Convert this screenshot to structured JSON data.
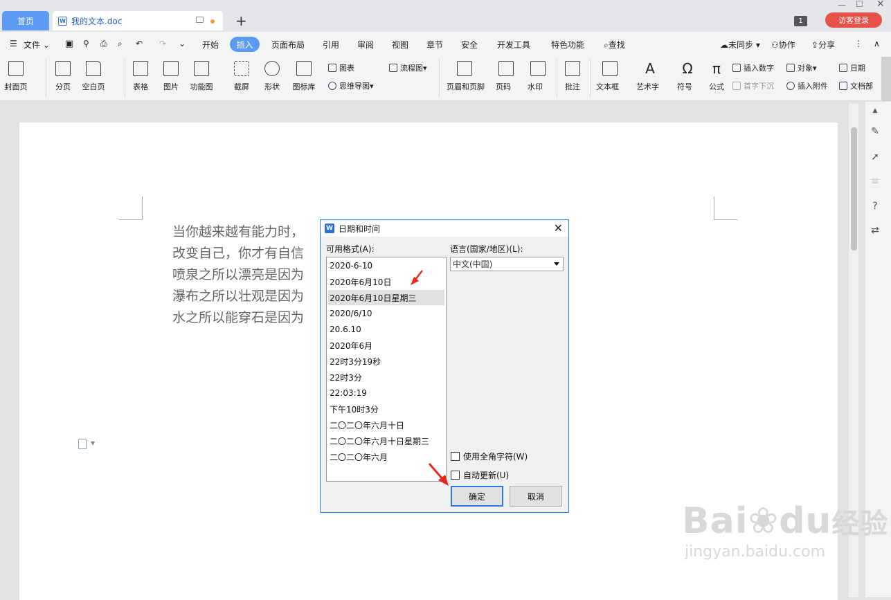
{
  "tabs": {
    "home": "首页",
    "doc": "我的文本.doc"
  },
  "topright": {
    "badge": "1",
    "login": "访客登录"
  },
  "menu": {
    "file": "文件",
    "items": [
      "开始",
      "插入",
      "页面布局",
      "引用",
      "审阅",
      "视图",
      "章节",
      "安全",
      "开发工具",
      "特色功能",
      "查找"
    ],
    "sync": "未同步",
    "collab": "协作",
    "share": "分享"
  },
  "ribbon": {
    "cover": "封面页",
    "pagebreak": "分页",
    "blank": "空白页",
    "table": "表格",
    "picture": "图片",
    "funcchart": "功能图",
    "screenshot": "截屏",
    "shape": "形状",
    "iconlib": "图标库",
    "chart": "图表",
    "mindmap": "思维导图",
    "flowchart": "流程图",
    "headerfooter": "页眉和页脚",
    "pagenum": "页码",
    "watermark": "水印",
    "comment": "批注",
    "textbox": "文本框",
    "wordart": "艺术字",
    "symbol": "符号",
    "formula": "公式",
    "insertnum": "插入数字",
    "object": "对象",
    "date": "日期",
    "dropcap": "首字下沉",
    "attach": "插入附件",
    "docpart": "文档部"
  },
  "document": {
    "lines": [
      "当你越来越有能力时，",
      "改变自己，你才有自信",
      "喷泉之所以漂亮是因为",
      "瀑布之所以壮观是因为",
      "水之所以能穿石是因为"
    ]
  },
  "dialog": {
    "title": "日期和时间",
    "formats_label": "可用格式(A):",
    "formats": [
      "2020-6-10",
      "2020年6月10日",
      "2020年6月10日星期三",
      "2020/6/10",
      "20.6.10",
      "2020年6月",
      "22时3分19秒",
      "22时3分",
      "22:03:19",
      "下午10时3分",
      "二〇二〇年六月十日",
      "二〇二〇年六月十日星期三",
      "二〇二〇年六月"
    ],
    "selected_index": 2,
    "language_label": "语言(国家/地区)(L):",
    "language_value": "中文(中国)",
    "fullwidth_label": "使用全角字符(W)",
    "autoupdate_label": "自动更新(U)",
    "ok": "确定",
    "cancel": "取消"
  },
  "watermark": {
    "brand": "Bai",
    "brand2": "du",
    "cn": "经验",
    "url": "jingyan.baidu.com"
  },
  "colors": {
    "accent": "#5b9bf1",
    "annotation_arrow": "#e8261c",
    "login": "#e4524a"
  }
}
